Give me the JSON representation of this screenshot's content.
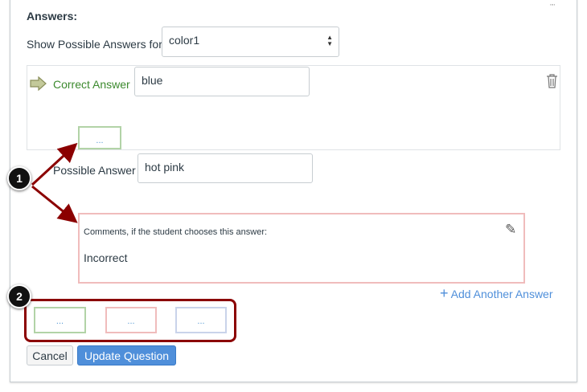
{
  "answers_heading": "Answers:",
  "show_for_label": "Show Possible Answers for",
  "show_for_value": "color1",
  "correct_answer": {
    "label": "Correct Answer",
    "value": "blue"
  },
  "possible_answer": {
    "label": "Possible Answer",
    "value": "hot pink"
  },
  "comment": {
    "label": "Comments, if the student chooses this answer:",
    "text": "Incorrect"
  },
  "comment_placeholder": "...",
  "add_answer": "Add Another Answer",
  "buttons": {
    "cancel": "Cancel",
    "update": "Update Question"
  },
  "callouts": [
    "1",
    "2"
  ],
  "colors": {
    "green": "#b2d3a7",
    "pink": "#f0bcbc",
    "blue_border": "#c9d3ea",
    "accent": "#4f8fda",
    "callout_red": "#8b0000"
  }
}
